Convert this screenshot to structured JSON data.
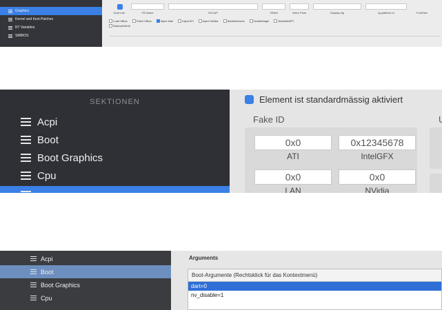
{
  "panel1": {
    "sidebar": [
      {
        "label": "Graphics",
        "selected": true
      },
      {
        "label": "Kernel and Kext Patches",
        "selected": false
      },
      {
        "label": "RT Variables",
        "selected": false
      },
      {
        "label": "SMBIOS",
        "selected": false
      }
    ],
    "top_fields": [
      "",
      "",
      "",
      "",
      "",
      ""
    ],
    "top_captions": [
      "Dual Link",
      "FB Name",
      "NVCAP",
      "VRAM",
      "Video Ports",
      "Display-cfg",
      "ig-platform-id",
      "FontSize"
    ],
    "checkboxes": [
      {
        "label": "Load VBios",
        "checked": false
      },
      {
        "label": "Patch VBios",
        "checked": false
      },
      {
        "label": "Inject Intel",
        "checked": true
      },
      {
        "label": "Inject ATI",
        "checked": false
      },
      {
        "label": "Inject NVidia",
        "checked": false
      },
      {
        "label": "NvidiaGeneric",
        "checked": false
      },
      {
        "label": "NvidiaSingle",
        "checked": false
      },
      {
        "label": "NvidiaNoEFI",
        "checked": false
      },
      {
        "label": "RadeonDeInit",
        "checked": false
      }
    ]
  },
  "panel2": {
    "section_header": "SEKTIONEN",
    "sidebar": [
      {
        "label": "Acpi",
        "selected": false
      },
      {
        "label": "Boot",
        "selected": false
      },
      {
        "label": "Boot Graphics",
        "selected": false
      },
      {
        "label": "Cpu",
        "selected": false
      },
      {
        "label": "",
        "selected": true
      }
    ],
    "enabled_checkbox_label": "Element ist standardmässig aktiviert",
    "fake_id_title": "Fake ID",
    "fields": [
      {
        "value": "0x0",
        "caption": "ATI"
      },
      {
        "value": "0x12345678",
        "caption": "IntelGFX"
      },
      {
        "value": "0x0",
        "caption": "LAN"
      },
      {
        "value": "0x0",
        "caption": "NVidia"
      }
    ],
    "side_letter": "U"
  },
  "panel3": {
    "sidebar": [
      {
        "label": "Acpi",
        "selected": false
      },
      {
        "label": "Boot",
        "selected": true
      },
      {
        "label": "Boot Graphics",
        "selected": false
      },
      {
        "label": "Cpu",
        "selected": false
      }
    ],
    "section_title": "Arguments",
    "boot_args_header": "Boot-Argumente (Rechtsklick für das Kontextmenü)",
    "boot_args": [
      {
        "value": "dart=0",
        "selected": true
      },
      {
        "value": "nv_disable=1",
        "selected": false
      }
    ]
  }
}
